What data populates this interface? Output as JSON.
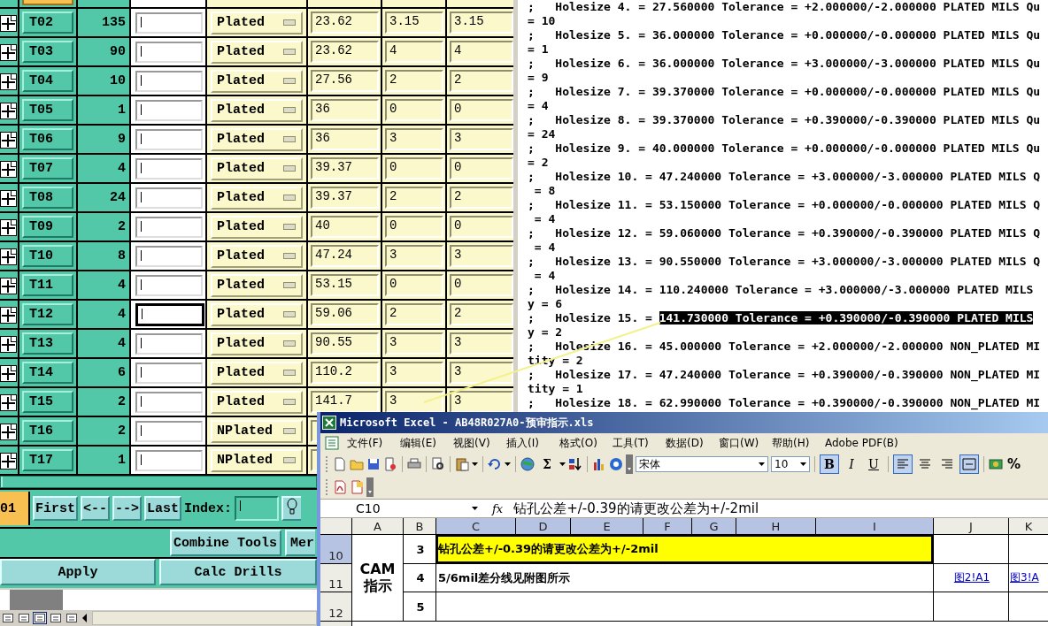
{
  "tool_table": {
    "rows": [
      {
        "tool": "T02",
        "count": "135",
        "focused": false,
        "plating": "Plated",
        "column_6": "23.62",
        "column_7": "3.15",
        "column_8": "3.15"
      },
      {
        "tool": "T03",
        "count": "90",
        "focused": false,
        "plating": "Plated",
        "column_6": "23.62",
        "column_7": "4",
        "column_8": "4"
      },
      {
        "tool": "T04",
        "count": "10",
        "focused": false,
        "plating": "Plated",
        "column_6": "27.56",
        "column_7": "2",
        "column_8": "2"
      },
      {
        "tool": "T05",
        "count": "1",
        "focused": false,
        "plating": "Plated",
        "column_6": "36",
        "column_7": "0",
        "column_8": "0"
      },
      {
        "tool": "T06",
        "count": "9",
        "focused": false,
        "plating": "Plated",
        "column_6": "36",
        "column_7": "3",
        "column_8": "3"
      },
      {
        "tool": "T07",
        "count": "4",
        "focused": false,
        "plating": "Plated",
        "column_6": "39.37",
        "column_7": "0",
        "column_8": "0"
      },
      {
        "tool": "T08",
        "count": "24",
        "focused": false,
        "plating": "Plated",
        "column_6": "39.37",
        "column_7": "2",
        "column_8": "2"
      },
      {
        "tool": "T09",
        "count": "2",
        "focused": false,
        "plating": "Plated",
        "column_6": "40",
        "column_7": "0",
        "column_8": "0"
      },
      {
        "tool": "T10",
        "count": "8",
        "focused": false,
        "plating": "Plated",
        "column_6": "47.24",
        "column_7": "3",
        "column_8": "3"
      },
      {
        "tool": "T11",
        "count": "4",
        "focused": false,
        "plating": "Plated",
        "column_6": "53.15",
        "column_7": "0",
        "column_8": "0"
      },
      {
        "tool": "T12",
        "count": "4",
        "focused": true,
        "plating": "Plated",
        "column_6": "59.06",
        "column_7": "2",
        "column_8": "2"
      },
      {
        "tool": "T13",
        "count": "4",
        "focused": false,
        "plating": "Plated",
        "column_6": "90.55",
        "column_7": "3",
        "column_8": "3"
      },
      {
        "tool": "T14",
        "count": "6",
        "focused": false,
        "plating": "Plated",
        "column_6": "110.2",
        "column_7": "3",
        "column_8": "3"
      },
      {
        "tool": "T15",
        "count": "2",
        "focused": false,
        "plating": "Plated",
        "column_6": "141.7",
        "column_7": "3",
        "column_8": "3"
      },
      {
        "tool": "T16",
        "count": "2",
        "focused": false,
        "plating": "NPlated"
      },
      {
        "tool": "T17",
        "count": "1",
        "focused": false,
        "plating": "NPlated"
      }
    ]
  },
  "navigation": {
    "current_tool": "01",
    "buttons": [
      "First",
      "<--",
      "-->",
      "Last"
    ],
    "index_label": "Index:"
  },
  "actions": {
    "row_1": [
      "Combine Tools",
      "Mer"
    ],
    "row_2": [
      "Apply",
      "Calc Drills"
    ]
  },
  "report": {
    "lines": [
      {
        "text": ";   Holesize 4. = 27.560000 Tolerance = +2.000000/-2.000000 PLATED MILS Qu"
      },
      {
        "text": "= 10"
      },
      {
        "text": ";   Holesize 5. = 36.000000 Tolerance = +0.000000/-0.000000 PLATED MILS Qu"
      },
      {
        "text": "= 1"
      },
      {
        "text": ";   Holesize 6. = 36.000000 Tolerance = +3.000000/-3.000000 PLATED MILS Qu"
      },
      {
        "text": "= 9"
      },
      {
        "text": ";   Holesize 7. = 39.370000 Tolerance = +0.000000/-0.000000 PLATED MILS Qu"
      },
      {
        "text": "= 4"
      },
      {
        "text": ";   Holesize 8. = 39.370000 Tolerance = +0.390000/-0.390000 PLATED MILS Qu"
      },
      {
        "text": "= 24"
      },
      {
        "text": ";   Holesize 9. = 40.000000 Tolerance = +0.000000/-0.000000 PLATED MILS Qu"
      },
      {
        "text": "= 2"
      },
      {
        "text": ";   Holesize 10. = 47.240000 Tolerance = +3.000000/-3.000000 PLATED MILS Q"
      },
      {
        "text": " = 8"
      },
      {
        "text": ";   Holesize 11. = 53.150000 Tolerance = +0.000000/-0.000000 PLATED MILS Q"
      },
      {
        "text": " = 4"
      },
      {
        "text": ";   Holesize 12. = 59.060000 Tolerance = +0.390000/-0.390000 PLATED MILS Q"
      },
      {
        "text": " = 4"
      },
      {
        "text": ";   Holesize 13. = 90.550000 Tolerance = +3.000000/-3.000000 PLATED MILS Q"
      },
      {
        "text": " = 4"
      },
      {
        "text": ";   Holesize 14. = 110.240000 Tolerance = +3.000000/-3.000000 PLATED MILS"
      },
      {
        "text": "y = 6"
      },
      {
        "text": ";   Holesize 15. = ",
        "highlight": "141.730000 Tolerance = +0.390000/-0.390000 PLATED MILS"
      },
      {
        "text": "y = 2"
      },
      {
        "text": ";   Holesize 16. = 45.000000 Tolerance = +2.000000/-2.000000 NON_PLATED MI"
      },
      {
        "text": "tity = 2"
      },
      {
        "text": ";   Holesize 17. = 47.240000 Tolerance = +0.390000/-0.390000 NON_PLATED MI"
      },
      {
        "text": "tity = 1"
      },
      {
        "text": ";   Holesize 18. = 62.990000 Tolerance = +0.390000/-0.390000 NON_PLATED MI"
      }
    ]
  },
  "excel": {
    "title": "Microsoft Excel - AB48R027A0-预审指示.xls",
    "menu": [
      "文件(F)",
      "编辑(E)",
      "视图(V)",
      "插入(I)",
      "格式(O)",
      "工具(T)",
      "数据(D)",
      "窗口(W)",
      "帮助(H)",
      "Adobe PDF(B)"
    ],
    "toolbar": {
      "sum": "Σ",
      "font": "宋体",
      "font_size": "10",
      "styles": [
        {
          "label": "B",
          "on": true
        },
        {
          "label": "I",
          "on": false
        },
        {
          "label": "U",
          "on": false
        }
      ],
      "alignments": [
        {
          "kind": "left",
          "on": true
        },
        {
          "kind": "center",
          "on": false
        },
        {
          "kind": "right",
          "on": false
        },
        {
          "kind": "merge",
          "on": true
        }
      ],
      "percent": "%"
    },
    "name_box": "C10",
    "function_label": "fx",
    "formula": "钻孔公差+/-0.39的请更改公差为+/-2mil",
    "columns": [
      {
        "label": "A",
        "selected": false
      },
      {
        "label": "B",
        "selected": false
      },
      {
        "label": "C",
        "selected": true
      },
      {
        "label": "D",
        "selected": true
      },
      {
        "label": "E",
        "selected": true
      },
      {
        "label": "F",
        "selected": true
      },
      {
        "label": "G",
        "selected": true
      },
      {
        "label": "H",
        "selected": true
      },
      {
        "label": "I",
        "selected": true
      },
      {
        "label": "J",
        "selected": false
      },
      {
        "label": "K",
        "selected": false
      }
    ],
    "group_label": "CAM 指示",
    "rows": [
      {
        "number": "10",
        "selected": true,
        "b": "3",
        "c": "钻孔公差+/-0.39的请更改公差为+/-2mil",
        "highlighted": true
      },
      {
        "number": "11",
        "selected": false,
        "b": "4",
        "c": "5/6mil差分线见附图所示",
        "highlighted": false,
        "j_link": "图2!A1",
        "k_link": "图3!A"
      },
      {
        "number": "12",
        "selected": false,
        "b": "5",
        "highlighted": false
      }
    ]
  }
}
